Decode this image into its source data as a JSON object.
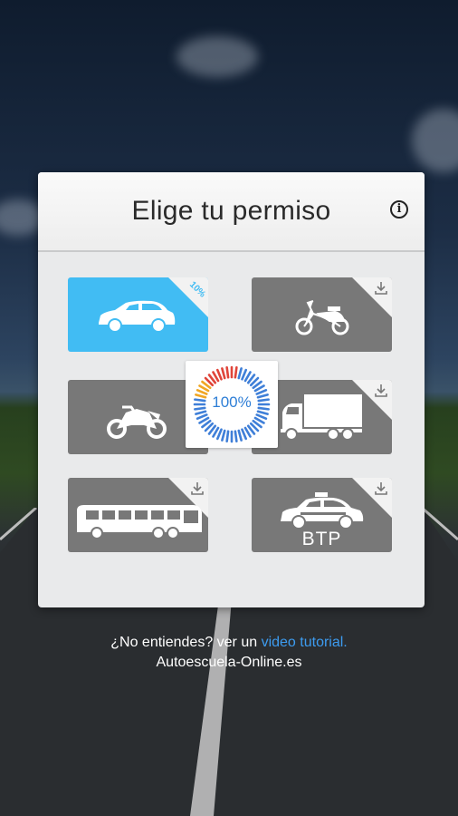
{
  "panel": {
    "title": "Elige tu permiso",
    "info_icon_glyph": "i"
  },
  "tiles": [
    {
      "id": "car",
      "label": "",
      "badge": "10%",
      "state": "selected",
      "icon": "car-icon",
      "color": "#41bcf3"
    },
    {
      "id": "moped",
      "label": "",
      "state": "download",
      "icon": "moped-icon",
      "color": "#787878"
    },
    {
      "id": "motorcycle",
      "label": "",
      "state": "download",
      "icon": "motorcycle-icon",
      "color": "#787878"
    },
    {
      "id": "truck",
      "label": "",
      "state": "download",
      "icon": "truck-icon",
      "color": "#787878"
    },
    {
      "id": "bus",
      "label": "",
      "state": "download",
      "icon": "bus-icon",
      "color": "#787878"
    },
    {
      "id": "taxi",
      "label": "BTP",
      "state": "download",
      "icon": "taxi-icon",
      "color": "#787878"
    }
  ],
  "progress": {
    "text": "100%",
    "value": 1.0
  },
  "footer": {
    "question": "¿No entiendes? ver un ",
    "link": "video tutorial.",
    "site": "Autoescuela-Online.es"
  }
}
